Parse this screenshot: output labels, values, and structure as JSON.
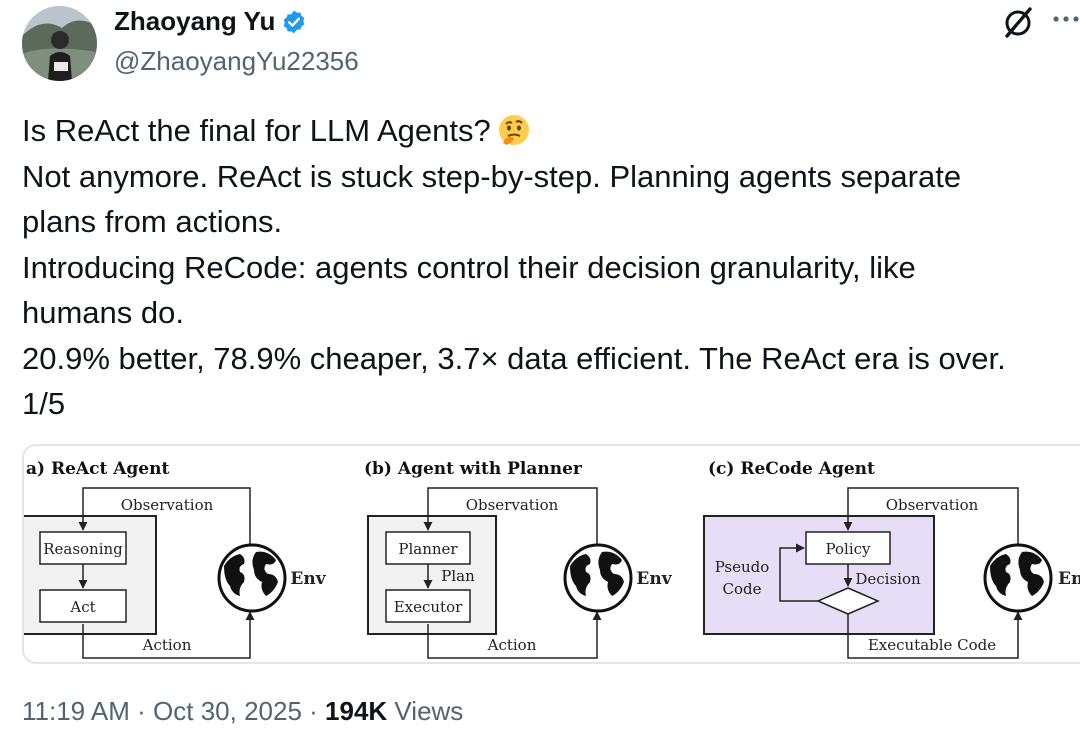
{
  "author": {
    "name": "Zhaoyang Yu",
    "handle": "@ZhaoyangYu22356",
    "verified": true,
    "avatar_icon": "avatar-photo"
  },
  "header_icons": [
    "grok-icon",
    "more-icon"
  ],
  "tweet": {
    "lines": [
      "Is ReAct the final for LLM Agents?",
      "Not anymore. ReAct is stuck step-by-step. Planning agents separate",
      "plans from actions.",
      "Introducing ReCode: agents control their decision granularity, like",
      "humans do.",
      "20.9% better, 78.9% cheaper, 3.7× data efficient. The ReAct era is over.",
      "1/5"
    ],
    "emoji_icon": "thinking-face-emoji"
  },
  "figure": {
    "panel_a": {
      "title": "a) ReAct Agent",
      "observation": "Observation",
      "reasoning": "Reasoning",
      "act": "Act",
      "action": "Action",
      "env": "Env"
    },
    "panel_b": {
      "title": "(b) Agent with Planner",
      "observation": "Observation",
      "planner": "Planner",
      "plan": "Plan",
      "executor": "Executor",
      "action": "Action",
      "env": "Env"
    },
    "panel_c": {
      "title": "(c) ReCode Agent",
      "observation": "Observation",
      "policy": "Policy",
      "pseudo": "Pseudo",
      "code": "Code",
      "decision": "Decision",
      "executable_code": "Executable Code",
      "env": "En"
    }
  },
  "meta": {
    "time": "11:19 AM",
    "sep1": " · ",
    "date": "Oct 30, 2025",
    "sep2": " · ",
    "views_count": "194K",
    "views_label": " Views"
  },
  "colors": {
    "text": "#0f1419",
    "muted": "#536471",
    "verified_blue": "#1d9bf0",
    "recode_fill": "#e6ddf6",
    "react_fill": "#f2f2f2"
  }
}
